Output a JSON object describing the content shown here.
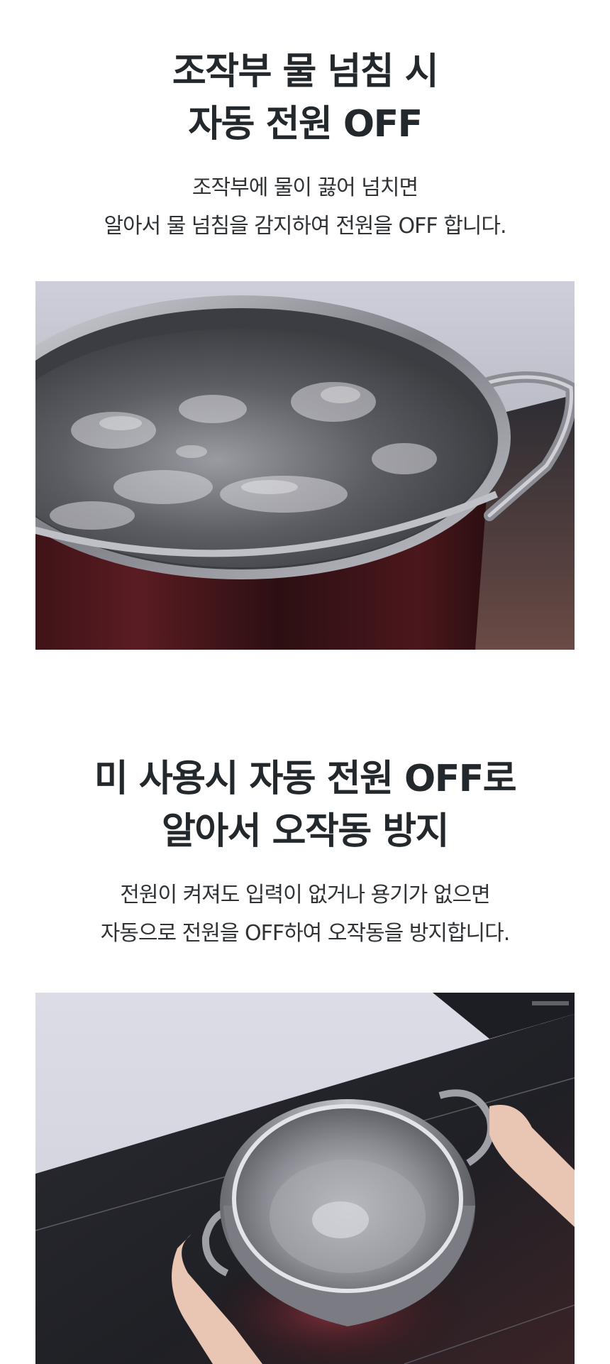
{
  "sections": [
    {
      "title_lines": [
        "조작부 물 넘침 시",
        "자동 전원 OFF"
      ],
      "desc_lines": [
        "조작부에 물이 끓어 넘치면",
        "알아서 물 넘침을 감지하여 전원을 OFF 합니다."
      ]
    },
    {
      "title_lines": [
        "미 사용시 자동 전원 OFF로",
        "알아서 오작동 방지"
      ],
      "desc_lines": [
        "전원이 켜져도 입력이 없거나 용기가 없으면",
        "자동으로 전원을 OFF하여 오작동을 방지합니다."
      ]
    }
  ]
}
